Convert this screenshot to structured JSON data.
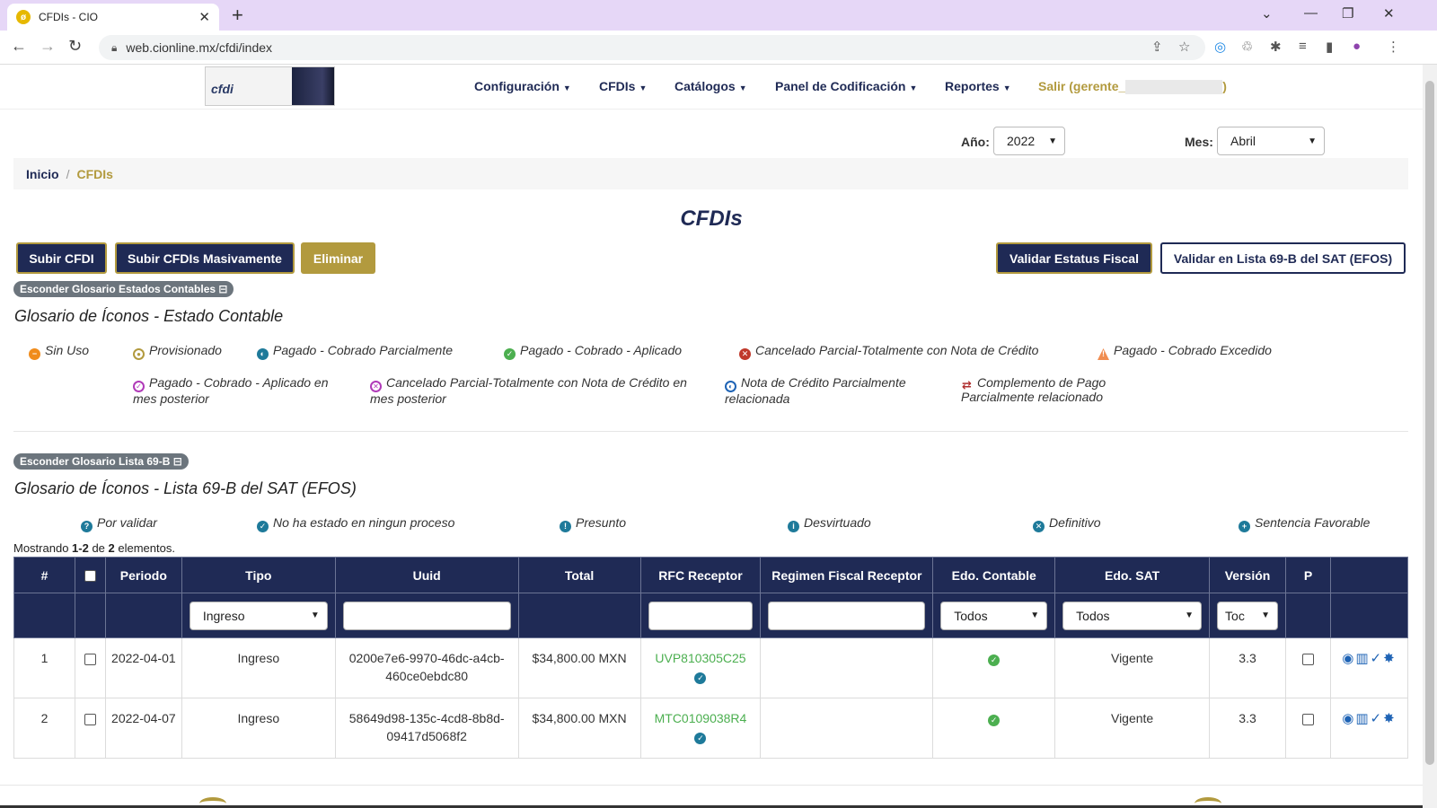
{
  "browser": {
    "tab_title": "CFDIs - CIO",
    "url": "web.cionline.mx/cfdi/index"
  },
  "header": {
    "menu": {
      "configuracion": "Configuración",
      "cfdis": "CFDIs",
      "catalogos": "Catálogos",
      "panel": "Panel de Codificación",
      "reportes": "Reportes",
      "salir_prefix": "Salir (gerente_",
      "salir_suffix": ")"
    }
  },
  "filters": {
    "anio_label": "Año:",
    "anio_value": "2022",
    "mes_label": "Mes:",
    "mes_value": "Abril"
  },
  "breadcrumb": {
    "home": "Inicio",
    "sep": "/",
    "current": "CFDIs"
  },
  "page_title": "CFDIs",
  "buttons": {
    "subir": "Subir CFDI",
    "subir_masivo": "Subir CFDIs Masivamente",
    "eliminar": "Eliminar",
    "validar_estatus": "Validar Estatus Fiscal",
    "validar_lista": "Validar en Lista 69-B del SAT (EFOS)"
  },
  "glosario_contable": {
    "toggle": "Esconder Glosario Estados Contables",
    "title": "Glosario de Íconos - Estado Contable",
    "items": [
      "Sin Uso",
      "Provisionado",
      "Pagado - Cobrado Parcialmente",
      "Pagado - Cobrado - Aplicado",
      "Cancelado Parcial-Totalmente con Nota de Crédito",
      "Pagado - Cobrado Excedido",
      "Pagado - Cobrado - Aplicado en mes posterior",
      "Cancelado Parcial-Totalmente con Nota de Crédito en mes posterior",
      "Nota de Crédito Parcialmente relacionada",
      "Complemento de Pago Parcialmente relacionado"
    ],
    "colors": {
      "sin_uso": "#f08c1c",
      "provisionado": "#b29a3e",
      "parcial": "#1e7a9a",
      "aplicado": "#4caf50",
      "cancelado": "#c0392b",
      "excedido": "#f08c50",
      "posterior": "#b03ab8",
      "nota": "#1e63b5",
      "complemento": "#b03030"
    }
  },
  "glosario_lista": {
    "toggle": "Esconder Glosario Lista 69-B",
    "title": "Glosario de Íconos - Lista 69-B del SAT (EFOS)",
    "items": [
      "Por validar",
      "No ha estado en ningun proceso",
      "Presunto",
      "Desvirtuado",
      "Definitivo",
      "Sentencia Favorable"
    ]
  },
  "summary": {
    "prefix": "Mostrando ",
    "range": "1-2",
    "mid": " de ",
    "count": "2",
    "suffix": " elementos."
  },
  "table": {
    "columns": [
      "#",
      "",
      "Periodo",
      "Tipo",
      "Uuid",
      "Total",
      "RFC Receptor",
      "Regimen Fiscal Receptor",
      "Edo. Contable",
      "Edo. SAT",
      "Versión",
      "P",
      ""
    ],
    "filter_values": {
      "tipo": "Ingreso",
      "edo_contable": "Todos",
      "edo_sat": "Todos",
      "version": "Toc"
    },
    "rows": [
      {
        "num": "1",
        "periodo": "2022-04-01",
        "tipo": "Ingreso",
        "uuid": "0200e7e6-9970-46dc-a4cb-460ce0ebdc80",
        "total": "$34,800.00 MXN",
        "rfc": "UVP810305C25",
        "regimen": "",
        "edo_sat": "Vigente",
        "version": "3.3"
      },
      {
        "num": "2",
        "periodo": "2022-04-07",
        "tipo": "Ingreso",
        "uuid": "58649d98-135c-4cd8-8b8d-09417d5068f2",
        "total": "$34,800.00 MXN",
        "rfc": "MTC0109038R4",
        "regimen": "",
        "edo_sat": "Vigente",
        "version": "3.3"
      }
    ]
  }
}
